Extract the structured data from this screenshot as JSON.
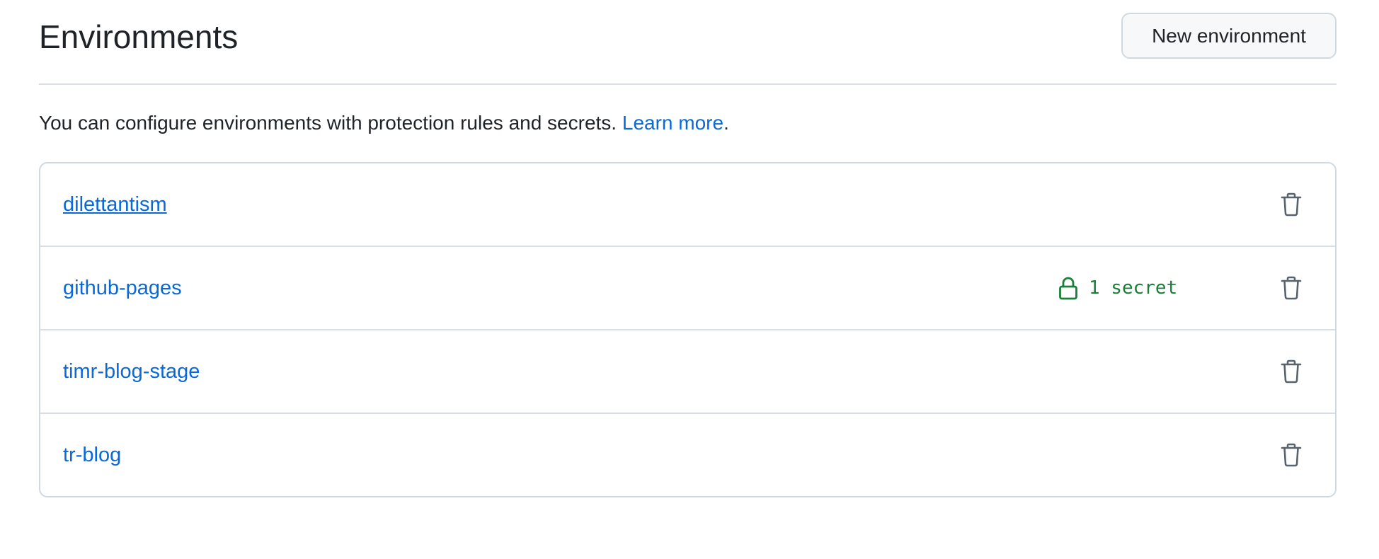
{
  "header": {
    "title": "Environments",
    "new_button_label": "New environment"
  },
  "description": {
    "text": "You can configure environments with protection rules and secrets. ",
    "link_label": "Learn more",
    "trailing": "."
  },
  "environments": [
    {
      "name": "dilettantism",
      "secrets": ""
    },
    {
      "name": "github-pages",
      "secrets": "1 secret"
    },
    {
      "name": "timr-blog-stage",
      "secrets": ""
    },
    {
      "name": "tr-blog",
      "secrets": ""
    }
  ],
  "icons": {
    "secret": "lock-icon",
    "delete": "trash-icon"
  },
  "colors": {
    "link": "#0969da",
    "secret": "#1a7f37",
    "border": "#d1d9e0",
    "icon": "#59636e"
  }
}
